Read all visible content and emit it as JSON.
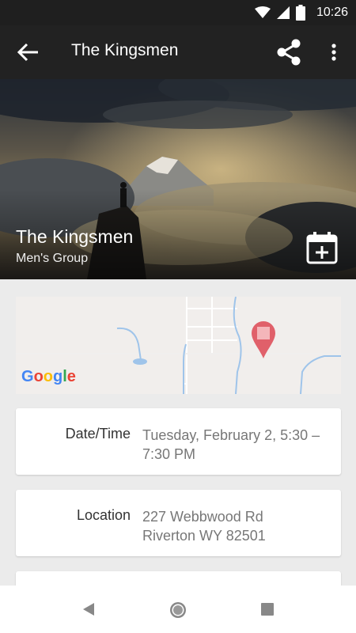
{
  "status_bar": {
    "time": "10:26"
  },
  "app_bar": {
    "title": "The Kingsmen"
  },
  "hero": {
    "title": "The Kingsmen",
    "subtitle": "Men's Group"
  },
  "map": {
    "logo_text": "Google"
  },
  "details": [
    {
      "label": "Date/Time",
      "value": "Tuesday, February 2, 5:30 – 7:30 PM"
    },
    {
      "label": "Location",
      "value_line1": "227 Webbwood Rd",
      "value_line2": "Riverton WY 82501"
    }
  ],
  "colors": {
    "app_bar": "#222222",
    "status_bar": "#1f1f1f",
    "map_pin": "#e0606a",
    "background": "#ebebeb"
  }
}
